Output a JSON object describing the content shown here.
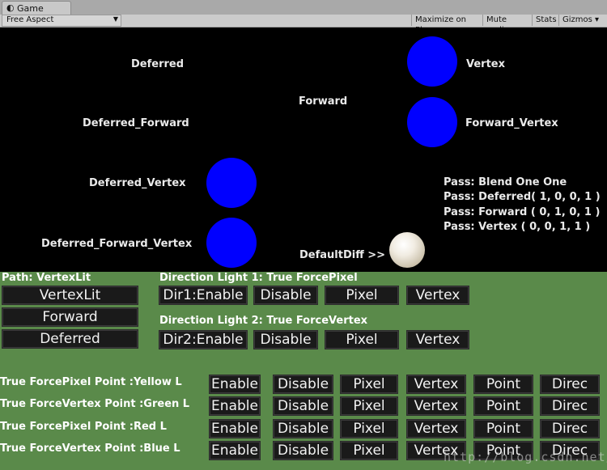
{
  "editor": {
    "tab_title": "Game",
    "aspect": "Free Aspect",
    "toolbar": [
      "Maximize on Play",
      "Mute audio",
      "Stats",
      "Gizmos"
    ],
    "gizmos_arrow": "▾"
  },
  "scene": {
    "labels": {
      "deferred": "Deferred",
      "vertex": "Vertex",
      "forward": "Forward",
      "deferred_forward": "Deferred_Forward",
      "forward_vertex": "Forward_Vertex",
      "deferred_vertex": "Deferred_Vertex",
      "deferred_forward_vertex": "Deferred_Forward_Vertex",
      "default_diff": "DefaultDiff  >>"
    },
    "passes": [
      "Pass: Blend One One",
      "Pass: Deferred(  1,  0,  0,  1 )",
      "Pass: Forward (  0,  1,  0,  1 )",
      "Pass: Vertex    (  0,  0,  1,  1 )"
    ],
    "colors": {
      "sphere": "#0000ff",
      "background": "#000000",
      "gui_background": "#5a8a4a"
    }
  },
  "gui": {
    "path_label": "Path: VertexLit",
    "path_buttons": [
      "VertexLit",
      "Forward",
      "Deferred"
    ],
    "dir1_label": "Direction Light 1:  True   ForcePixel",
    "dir1_buttons": [
      "Dir1:Enable",
      "Disable",
      "Pixel",
      "Vertex"
    ],
    "dir2_label": "Direction Light 2:  True   ForceVertex",
    "dir2_buttons": [
      "Dir2:Enable",
      "Disable",
      "Pixel",
      "Vertex"
    ],
    "point_lights": [
      {
        "label": "True  ForcePixel  Point :Yellow L"
      },
      {
        "label": "True  ForceVertex  Point :Green L"
      },
      {
        "label": "True  ForcePixel  Point :Red L"
      },
      {
        "label": "True  ForceVertex  Point :Blue L"
      }
    ],
    "point_buttons": [
      "Enable",
      "Disable",
      "Pixel",
      "Vertex",
      "Point",
      "Direc"
    ],
    "watermark": "http://blog.csdn.net/"
  }
}
